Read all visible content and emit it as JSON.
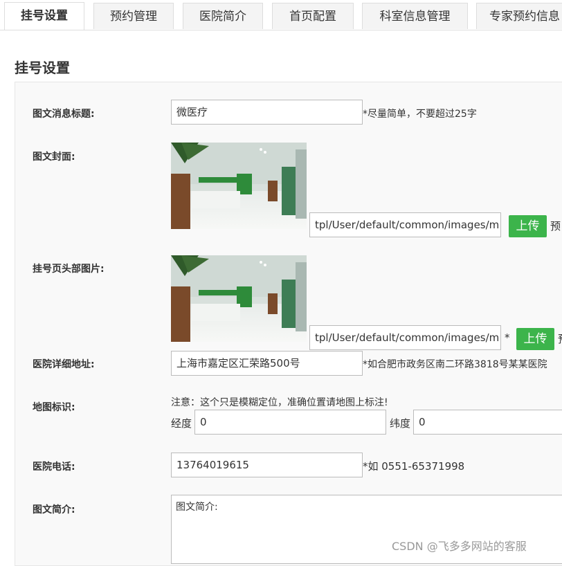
{
  "tabs": [
    {
      "label": "挂号设置",
      "active": true
    },
    {
      "label": "预约管理"
    },
    {
      "label": "医院简介"
    },
    {
      "label": "首页配置"
    },
    {
      "label": "科室信息管理"
    },
    {
      "label": "专家预约信息"
    }
  ],
  "page_title": "挂号设置",
  "form": {
    "news_title": {
      "label": "图文消息标题:",
      "value": "微医疗",
      "hint": "*尽量简单，不要超过25字"
    },
    "cover": {
      "label": "图文封面:",
      "path": "tpl/User/default/common/images/m",
      "upload": "上传",
      "extra": "预"
    },
    "header_image": {
      "label": "挂号页头部图片:",
      "path": "tpl/User/default/common/images/m",
      "star": "*",
      "upload": "上传",
      "extra": "预"
    },
    "address": {
      "label": "医院详细地址:",
      "value": "上海市嘉定区汇荣路500号",
      "hint": "*如合肥市政务区南二环路3818号某某医院"
    },
    "map": {
      "label": "地图标识:",
      "note": "注意：这个只是模糊定位，准确位置请地图上标注!",
      "lng_label": "经度",
      "lng_value": "0",
      "lat_label": "纬度",
      "lat_value": "0"
    },
    "phone": {
      "label": "医院电话:",
      "value": "13764019615",
      "hint": "*如 0551-65371998"
    },
    "intro": {
      "label": "图文简介:",
      "value": "图文简介:"
    }
  },
  "watermark": "CSDN @飞多多网站的客服",
  "colors": {
    "upload_button": "#3cb44b",
    "panel_bg": "#f9f9f9"
  }
}
